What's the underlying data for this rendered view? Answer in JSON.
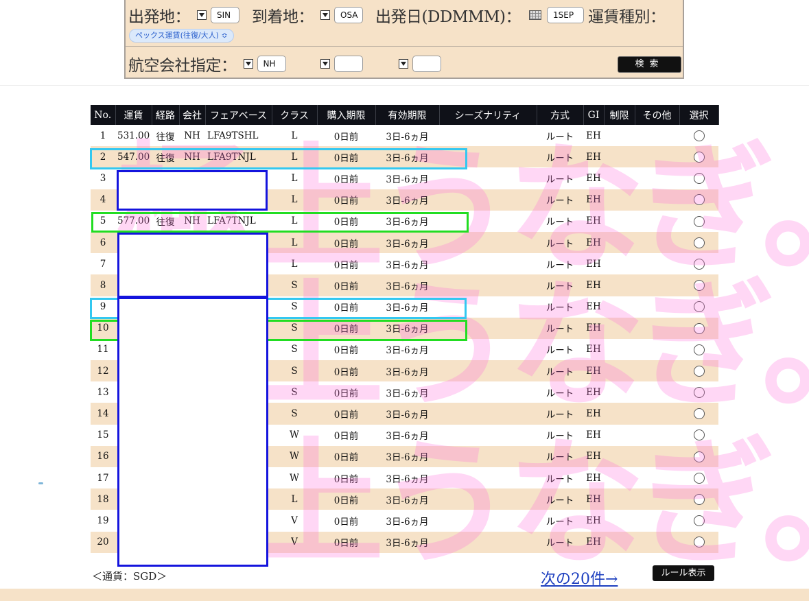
{
  "search": {
    "departure_label": "出発地：",
    "departure_value": "SIN",
    "arrival_label": "到着地：",
    "arrival_value": "OSA",
    "date_label": "出発日(DDMMM)：",
    "date_value": "1SEP",
    "fare_type_label": "運賃種別：",
    "fare_type_value": "ペックス運賃(往復/大人) ≎",
    "airline_label": "航空会社指定：",
    "airline_value_1": "NH",
    "airline_value_2": "",
    "airline_value_3": "",
    "search_button": "検索"
  },
  "table": {
    "headers": [
      "No.",
      "運賃",
      "経路",
      "会社",
      "フェアベース",
      "クラス",
      "購入期限",
      "有効期限",
      "シーズナリティ",
      "方式",
      "GI",
      "制限",
      "その他",
      "選択"
    ],
    "rows": [
      {
        "no": "1",
        "fare": "531.00",
        "route": "往復",
        "airline": "NH",
        "farebase": "LFA9TSHL",
        "cls": "L",
        "purchase": "0日前",
        "validity": "3日-6ヵ月",
        "season": "",
        "method": "ルート",
        "gi": "EH",
        "limit": "",
        "other": ""
      },
      {
        "no": "2",
        "fare": "547.00",
        "route": "往復",
        "airline": "NH",
        "farebase": "LFA9TNJL",
        "cls": "L",
        "purchase": "0日前",
        "validity": "3日-6ヵ月",
        "season": "",
        "method": "ルート",
        "gi": "EH",
        "limit": "",
        "other": ""
      },
      {
        "no": "3",
        "fare": "",
        "route": "",
        "airline": "",
        "farebase": "",
        "cls": "L",
        "purchase": "0日前",
        "validity": "3日-6ヵ月",
        "season": "",
        "method": "ルート",
        "gi": "EH",
        "limit": "",
        "other": ""
      },
      {
        "no": "4",
        "fare": "",
        "route": "",
        "airline": "",
        "farebase": "",
        "cls": "L",
        "purchase": "0日前",
        "validity": "3日-6ヵ月",
        "season": "",
        "method": "ルート",
        "gi": "EH",
        "limit": "",
        "other": ""
      },
      {
        "no": "5",
        "fare": "577.00",
        "route": "往復",
        "airline": "NH",
        "farebase": "LFA7TNJL",
        "cls": "L",
        "purchase": "0日前",
        "validity": "3日-6ヵ月",
        "season": "",
        "method": "ルート",
        "gi": "EH",
        "limit": "",
        "other": ""
      },
      {
        "no": "6",
        "fare": "",
        "route": "",
        "airline": "",
        "farebase": "",
        "cls": "L",
        "purchase": "0日前",
        "validity": "3日-6ヵ月",
        "season": "",
        "method": "ルート",
        "gi": "EH",
        "limit": "",
        "other": ""
      },
      {
        "no": "7",
        "fare": "",
        "route": "",
        "airline": "",
        "farebase": "",
        "cls": "L",
        "purchase": "0日前",
        "validity": "3日-6ヵ月",
        "season": "",
        "method": "ルート",
        "gi": "EH",
        "limit": "",
        "other": ""
      },
      {
        "no": "8",
        "fare": "",
        "route": "",
        "airline": "",
        "farebase": "",
        "cls": "S",
        "purchase": "0日前",
        "validity": "3日-6ヵ月",
        "season": "",
        "method": "ルート",
        "gi": "EH",
        "limit": "",
        "other": ""
      },
      {
        "no": "9",
        "fare": "",
        "route": "",
        "airline": "",
        "farebase": "",
        "cls": "S",
        "purchase": "0日前",
        "validity": "3日-6ヵ月",
        "season": "",
        "method": "ルート",
        "gi": "EH",
        "limit": "",
        "other": ""
      },
      {
        "no": "10",
        "fare": "",
        "route": "",
        "airline": "",
        "farebase": "",
        "cls": "S",
        "purchase": "0日前",
        "validity": "3日-6ヵ月",
        "season": "",
        "method": "ルート",
        "gi": "EH",
        "limit": "",
        "other": ""
      },
      {
        "no": "11",
        "fare": "",
        "route": "",
        "airline": "",
        "farebase": "",
        "cls": "S",
        "purchase": "0日前",
        "validity": "3日-6ヵ月",
        "season": "",
        "method": "ルート",
        "gi": "EH",
        "limit": "",
        "other": ""
      },
      {
        "no": "12",
        "fare": "",
        "route": "",
        "airline": "",
        "farebase": "",
        "cls": "S",
        "purchase": "0日前",
        "validity": "3日-6ヵ月",
        "season": "",
        "method": "ルート",
        "gi": "EH",
        "limit": "",
        "other": ""
      },
      {
        "no": "13",
        "fare": "",
        "route": "",
        "airline": "",
        "farebase": "",
        "cls": "S",
        "purchase": "0日前",
        "validity": "3日-6ヵ月",
        "season": "",
        "method": "ルート",
        "gi": "EH",
        "limit": "",
        "other": ""
      },
      {
        "no": "14",
        "fare": "",
        "route": "",
        "airline": "",
        "farebase": "",
        "cls": "S",
        "purchase": "0日前",
        "validity": "3日-6ヵ月",
        "season": "",
        "method": "ルート",
        "gi": "EH",
        "limit": "",
        "other": ""
      },
      {
        "no": "15",
        "fare": "",
        "route": "",
        "airline": "",
        "farebase": "",
        "cls": "W",
        "purchase": "0日前",
        "validity": "3日-6ヵ月",
        "season": "",
        "method": "ルート",
        "gi": "EH",
        "limit": "",
        "other": ""
      },
      {
        "no": "16",
        "fare": "",
        "route": "",
        "airline": "",
        "farebase": "",
        "cls": "W",
        "purchase": "0日前",
        "validity": "3日-6ヵ月",
        "season": "",
        "method": "ルート",
        "gi": "EH",
        "limit": "",
        "other": ""
      },
      {
        "no": "17",
        "fare": "",
        "route": "",
        "airline": "",
        "farebase": "",
        "cls": "W",
        "purchase": "0日前",
        "validity": "3日-6ヵ月",
        "season": "",
        "method": "ルート",
        "gi": "EH",
        "limit": "",
        "other": ""
      },
      {
        "no": "18",
        "fare": "",
        "route": "",
        "airline": "",
        "farebase": "",
        "cls": "L",
        "purchase": "0日前",
        "validity": "3日-6ヵ月",
        "season": "",
        "method": "ルート",
        "gi": "EH",
        "limit": "",
        "other": ""
      },
      {
        "no": "19",
        "fare": "",
        "route": "",
        "airline": "",
        "farebase": "",
        "cls": "V",
        "purchase": "0日前",
        "validity": "3日-6ヵ月",
        "season": "",
        "method": "ルート",
        "gi": "EH",
        "limit": "",
        "other": ""
      },
      {
        "no": "20",
        "fare": "",
        "route": "",
        "airline": "",
        "farebase": "",
        "cls": "V",
        "purchase": "0日前",
        "validity": "3日-6ヵ月",
        "season": "",
        "method": "ルート",
        "gi": "EH",
        "limit": "",
        "other": ""
      }
    ]
  },
  "footer": {
    "currency": "＜通貨：SGD＞",
    "next_link": "次の20件→",
    "rule_button": "ルール表示"
  },
  "watermark": {
    "line1": "極上うなぎ。",
    "line2": "極上うなぎ。",
    "line3": "極上うなぎ。"
  },
  "colors": {
    "panel_bg": "#f6e2c8",
    "header_bg": "#0f1118",
    "highlight_cyan": "#33c8f0",
    "highlight_green": "#22dd22",
    "redaction_blue": "#1414dd",
    "watermark_pink": "#ff6edc"
  }
}
